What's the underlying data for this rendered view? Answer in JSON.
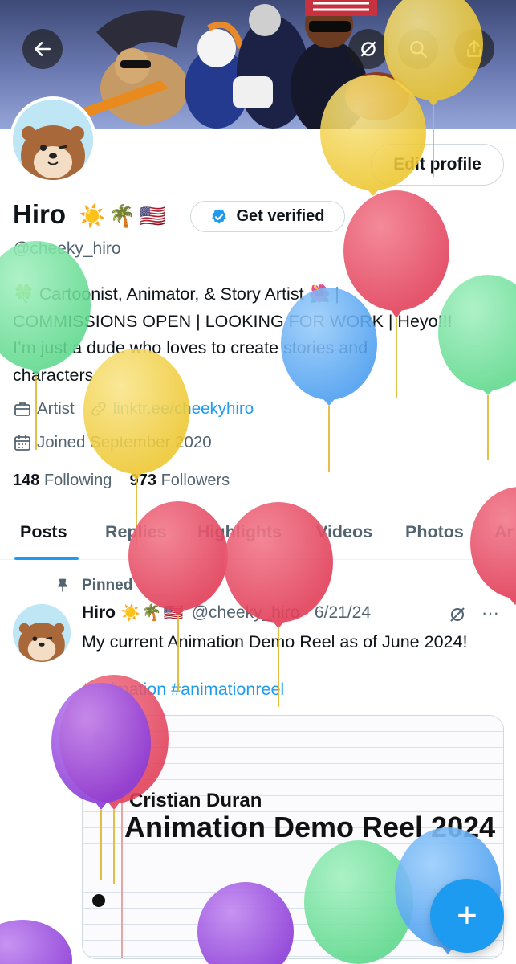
{
  "header": {
    "back_icon": "arrow-left-icon",
    "icons": [
      "grok-icon",
      "search-icon",
      "share-icon"
    ]
  },
  "profile": {
    "edit_label": "Edit profile",
    "name": "Hiro",
    "name_emoji": "☀️🌴🇺🇸",
    "get_verified": "Get verified",
    "handle": "@cheeky_hiro",
    "bio_line1": "🍀 Cartoonist, Animator, & Story Artist 🌺 |",
    "bio_line2": "COMMISSIONS OPEN | LOOKING FOR WORK | Heyo!!!",
    "bio_line3": "I’m just a dude who loves to create stories and",
    "bio_line4": "characters",
    "profession": "Artist",
    "link": "linktr.ee/cheekyhiro",
    "joined": "Joined September 2020",
    "following_count": "148",
    "following_label": "Following",
    "followers_count": "973",
    "followers_label": "Followers"
  },
  "tabs": [
    "Posts",
    "Replies",
    "Highlights",
    "Videos",
    "Photos",
    "Ar"
  ],
  "post": {
    "pinned_label": "Pinned",
    "name": "Hiro",
    "name_emoji": "☀️🌴🇺🇸",
    "handle_date": "@cheeky_hiro · 6/21/24",
    "text": "My current Animation Demo Reel as of June 2024!",
    "hashtags": "#animation #animationreel",
    "more": "···",
    "media_author": "Cristian Duran",
    "media_title": "Animation Demo Reel 2024"
  },
  "fab": {
    "label": "+"
  },
  "colors": {
    "accent": "#1d9bf0",
    "text": "#0f1419",
    "muted": "#536471",
    "balloon_yellow": "#f2cf3a",
    "balloon_red": "#e8425c",
    "balloon_green": "#6ee29a",
    "balloon_blue": "#5aa9f5",
    "balloon_purple": "#9a4fe0"
  }
}
